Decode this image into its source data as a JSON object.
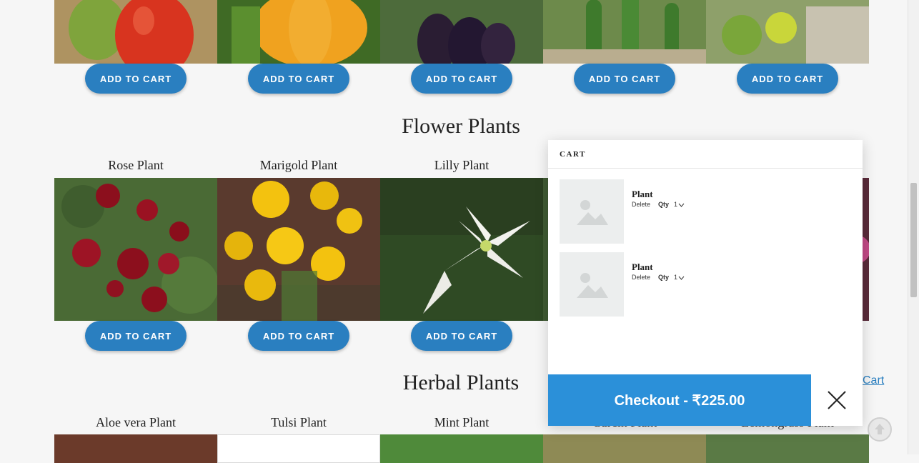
{
  "top_row": {
    "add_label": "ADD TO CART",
    "images": [
      "tomato-plant-photo",
      "pumpkin-plant-photo",
      "eggplant-plant-photo",
      "cucumber-plant-photo",
      "lemon-plant-photo"
    ]
  },
  "flower_section": {
    "title": "Flower Plants",
    "plants": [
      {
        "name": "Rose Plant",
        "add_label": "ADD TO CART"
      },
      {
        "name": "Marigold Plant",
        "add_label": "ADD TO CART"
      },
      {
        "name": "Lilly Plant",
        "add_label": "ADD TO CART"
      }
    ]
  },
  "herbal_section": {
    "title": "Herbal Plants",
    "plants": [
      {
        "name": "Aloe vera Plant"
      },
      {
        "name": "Tulsi Plant"
      },
      {
        "name": "Mint Plant"
      },
      {
        "name": "Curcin Plant"
      },
      {
        "name": "Lemongrass Plant"
      }
    ]
  },
  "cart_link": "Cart",
  "cart": {
    "header": "CART",
    "items": [
      {
        "name": "Plant",
        "delete_label": "Delete",
        "qty_label": "Qty",
        "qty_value": "1"
      },
      {
        "name": "Plant",
        "delete_label": "Delete",
        "qty_label": "Qty",
        "qty_value": "1"
      }
    ],
    "checkout_label": "Checkout - ₹225.00"
  },
  "colors": {
    "accent": "#2b90d9",
    "button": "#2a7fc0",
    "page_bg": "#f6f6f6"
  }
}
